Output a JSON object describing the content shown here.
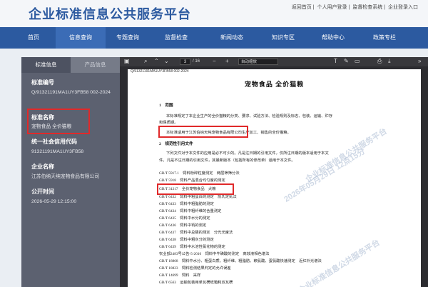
{
  "header": {
    "title": "企业标准信息公共服务平台",
    "top_links": [
      "返回首页",
      "个人用户登录",
      "监督检查系统",
      "企业登录入口"
    ]
  },
  "nav": {
    "items": [
      "首页",
      "信息查询",
      "专题查询",
      "监督检查",
      "新闻动态",
      "知识专区",
      "帮助中心",
      "政策专栏"
    ],
    "active": "信息查询"
  },
  "left_panel": {
    "tabs": [
      "标准信息",
      "产品信息"
    ],
    "fields": [
      {
        "label": "标准编号",
        "value": "Q/91321191MA1UY3FB58 002-2024"
      },
      {
        "label": "标准名称",
        "value": "宠物食品 全价猫粮"
      },
      {
        "label": "统一社会信用代码",
        "value": "91321191MA1UY3FB58"
      },
      {
        "label": "企业名称",
        "value": "江苏伯纳天纯宠物食品有限公司"
      },
      {
        "label": "公开时间",
        "value": "2026-05-29 12:15:00"
      }
    ]
  },
  "pdf": {
    "page_current": "3",
    "page_total": "/ 16",
    "zoom": "自动缩放",
    "doc_header": "Q/91321191MA1UY3FB58 002-2024",
    "doc_title": "宠物食品 全价猫粮",
    "section1": "1　范围",
    "para1": "本标准规定了本企业生产的全价猫粮的分类、要求、试验方法、检验规则及标志、包装、运输、贮存",
    "para1b": "和保质期。",
    "para2": "本标准适用于江苏伯纳天纯宠物食品有限公司生产加工、销售的全价猫粮。",
    "section2": "2　规范性引用文件",
    "para3": "下列文件对于本文件的应用是必不可少的。凡是注日期的引用文件，仅所注日期的版本适用于本文",
    "para4": "件。凡是不注日期的引用文件，其最新版本（包括所有的修改单）适用于本文件。",
    "refs": [
      "GB/T 5917.1　饲料粉碎粒度测定　两层筛筛分法",
      "GB/T 5918　饲料产品混合均匀度的测定",
      "GB/T 31217　全价宠物食品　犬粮",
      "GB/T 6432　饲料中粗蛋白的测定　凯氏定氮法",
      "GB/T 6433　饲料中粗脂肪的测定",
      "GB/T 6434　饲料中粗纤维的含量测定",
      "GB/T 6435　饲料中水分的测定",
      "GB/T 6436　饲料中钙的测定",
      "GB/T 6437　饲料中总磷的测定　分光光度法",
      "GB/T 6438　饲料中粗灰分的测定",
      "GB/T 6439　饲料中水溶性氯化物的测定",
      "农业部2483号公告-5-2016　饲料中牛磺酸的测定　高效液相色谱法",
      "GB/T 18868　饲料中水分、粗蛋白质、粗纤维、粗脂肪、赖氨酸、蛋氨酸快速测定　近红外光谱法",
      "GB/T 18823　饲料检测结果判定的允许误差",
      "GB/T 14699　饲料　采样",
      "GB/T 6563　运输包装用单瓦楞纸箱和双瓦楞"
    ],
    "watermarks": [
      "企业标准信息公共服务平台",
      "2026年05月29日 12点15分"
    ]
  }
}
